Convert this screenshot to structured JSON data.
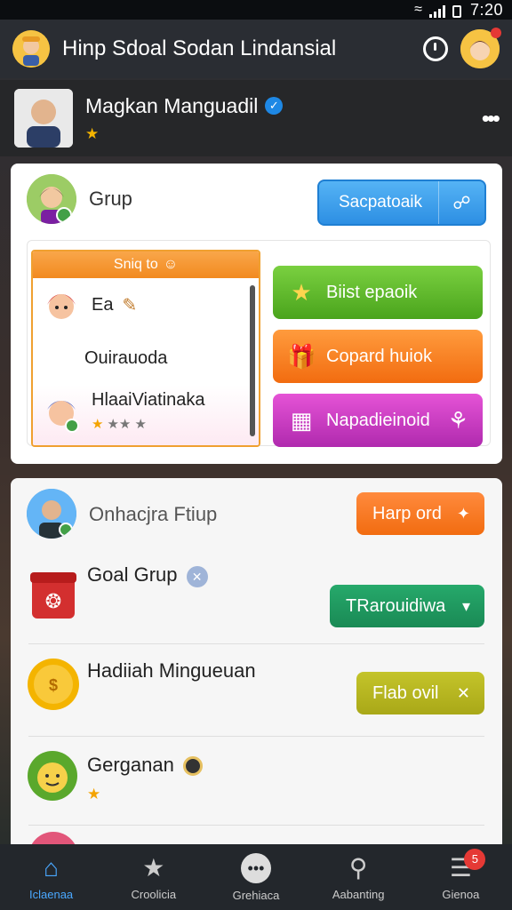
{
  "status": {
    "time": "7:20"
  },
  "appbar": {
    "title": "Hinp Sdoal Sodan Lindansial"
  },
  "profile": {
    "name": "Magkan Manguadil",
    "sub": ""
  },
  "group_card": {
    "label": "Grup",
    "share_label": "Sacpatoaik",
    "list_header": "Sniq to",
    "list_items": [
      {
        "label": "Ea"
      },
      {
        "label": "Ouirauoda"
      },
      {
        "label": "HlaaiViatinaka",
        "meta": "★★ ★"
      }
    ],
    "actions": [
      {
        "label": "Biist epaoik",
        "icon": "★"
      },
      {
        "label": "Copard huiok",
        "icon": "🎁"
      },
      {
        "label": "Napadieinoid",
        "icon": "⚘"
      }
    ]
  },
  "feed": {
    "header_title": "Onhacjra Ftiup",
    "header_button": "Harp ord",
    "items": [
      {
        "title": "Goal Grup",
        "sub": "",
        "button": "TRarouidiwa",
        "button_icon": "▾"
      },
      {
        "title": "Hadiiah Mingueuan",
        "sub": "",
        "button": "Flab ovil",
        "button_icon": "✕"
      },
      {
        "title": "Gerganan",
        "sub": ""
      }
    ]
  },
  "nav": [
    {
      "label": "Iclaenaa",
      "icon": "⌂"
    },
    {
      "label": "Croolicia",
      "icon": "★"
    },
    {
      "label": "Grehiaca",
      "icon": "•••"
    },
    {
      "label": "Aabanting",
      "icon": "⚲"
    },
    {
      "label": "Gienoa",
      "icon": "☰",
      "badge": "5"
    }
  ],
  "colors": {
    "accent_blue": "#2d8fe3",
    "green": "#4aa41c",
    "orange": "#f26c10",
    "magenta": "#b02aae",
    "teal_green": "#1f9a5b",
    "olive": "#b9b822",
    "badge_red": "#e53935"
  }
}
